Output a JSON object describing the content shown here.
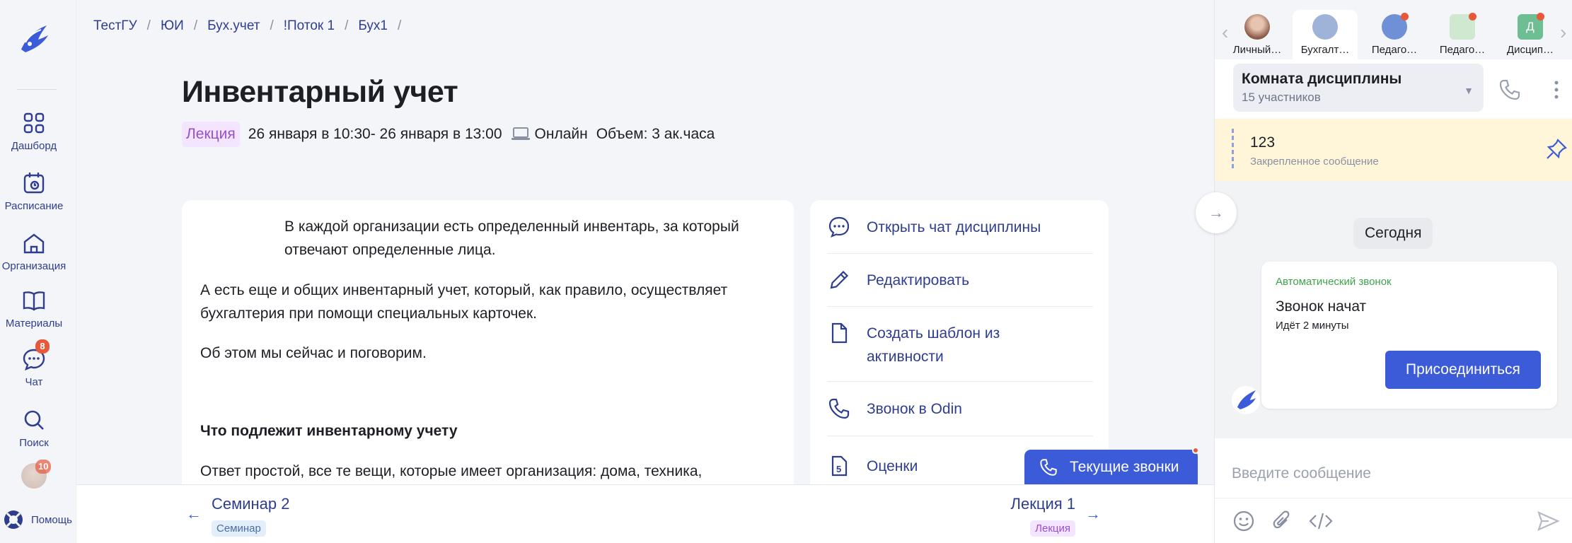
{
  "sidebar": {
    "items": [
      {
        "label": "Дашборд",
        "icon": "grid-icon"
      },
      {
        "label": "Расписание",
        "icon": "calendar-icon"
      },
      {
        "label": "Организация",
        "icon": "home-icon"
      },
      {
        "label": "Материалы",
        "icon": "book-icon"
      },
      {
        "label": "Чат",
        "icon": "chat-icon",
        "badge": "8"
      },
      {
        "label": "Поиск",
        "icon": "search-icon"
      }
    ],
    "avatar_badge": "10",
    "help_label": "Помощь"
  },
  "breadcrumbs": [
    "ТестГУ",
    "ЮИ",
    "Бух.учет",
    "!Поток 1",
    "Бух1",
    ""
  ],
  "page": {
    "title": "Инвентарный учет",
    "type_tag": "Лекция",
    "time": "26 января в 10:30- 26 января в 13:00",
    "format": "Онлайн",
    "volume": "Объем: 3 ак.часа"
  },
  "content": {
    "p1_line1": "В каждой организации есть определенный инвентарь, за который",
    "p1_line2": "отвечают определенные лица.",
    "p2_line1": "А есть еще и общих инвентарный учет, который, как правило, осуществляет",
    "p2_line2": "бухгалтерия при помощи специальных карточек.",
    "p3": "Об этом мы сейчас и поговорим.",
    "heading": "Что подлежит инвентарному учету",
    "p4": "Ответ простой, все те вещи, которые имеет организация: дома, техника,"
  },
  "actions": {
    "open_chat": "Открыть чат дисциплины",
    "edit": "Редактировать",
    "template_line1": "Создать шаблон из",
    "template_line2": "активности",
    "call": "Звонок в Odin",
    "grades": "Оценки"
  },
  "current_calls": "Текущие звонки",
  "pager": {
    "prev_title": "Семинар 2",
    "prev_tag": "Семинар",
    "next_title": "Лекция 1",
    "next_tag": "Лекция"
  },
  "chat": {
    "tabs": [
      {
        "label": "Личный…",
        "dot": false,
        "active": false
      },
      {
        "label": "Бухгалт…",
        "dot": false,
        "active": true
      },
      {
        "label": "Педаго…",
        "dot": true,
        "active": false
      },
      {
        "label": "Педаго…",
        "dot": true,
        "active": false
      },
      {
        "label": "Дисцип…",
        "dot": true,
        "active": false,
        "letter": "Д"
      }
    ],
    "room_name": "Комната дисциплины",
    "participants": "15 участников",
    "pinned_text": "123",
    "pinned_label": "Закрепленное сообщение",
    "date_divider": "Сегодня",
    "message": {
      "kind": "Автоматический звонок",
      "status": "Звонок начат",
      "duration": "Идёт 2 минуты",
      "join_label": "Присоединиться"
    },
    "input_placeholder": "Введите сообщение"
  },
  "colors": {
    "accent": "#3c5bd9",
    "link": "#2f3d8f",
    "badge": "#e8583a",
    "lecture_tag_bg": "#f3e5ff",
    "pinned_bg": "#fff6d9"
  }
}
